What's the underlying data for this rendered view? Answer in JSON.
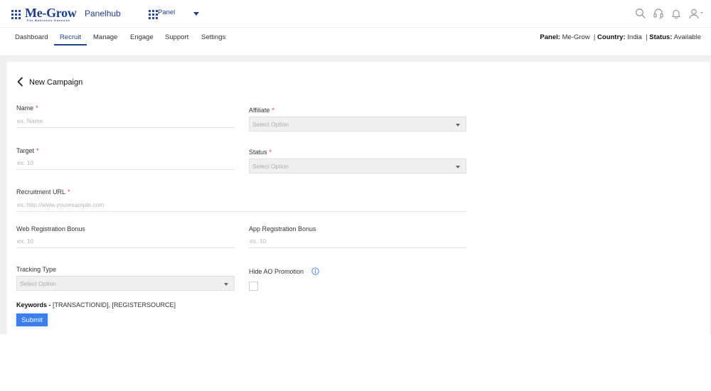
{
  "header": {
    "logo_text": "Me-Grow",
    "logo_subtext": "For Business Success",
    "brand": "Panelhub",
    "panel_select": "Panel",
    "icons": [
      "apps-grid-icon",
      "panel-grid-icon",
      "search-icon",
      "headset-icon",
      "bell-icon",
      "user-icon"
    ]
  },
  "nav": {
    "items": [
      "Dashboard",
      "Recruit",
      "Manage",
      "Engage",
      "Support",
      "Settings"
    ],
    "active": "Recruit"
  },
  "status": {
    "panel_label": "Panel",
    "panel_value": "Me-Grow",
    "country_label": "Country",
    "country_value": "India",
    "status_label": "Status",
    "status_value": "Available"
  },
  "page": {
    "title": "New Campaign"
  },
  "form": {
    "name": {
      "label": "Name",
      "placeholder": "ex. Name"
    },
    "affiliate": {
      "label": "Affiliate",
      "value": "Select Option"
    },
    "target": {
      "label": "Target",
      "placeholder": "ex. 10"
    },
    "status": {
      "label": "Status",
      "value": "Select Option"
    },
    "recruitment_url": {
      "label": "Recruitment URL",
      "placeholder": "ex. http://www.yourexample.com"
    },
    "web_bonus": {
      "label": "Web Registration Bonus",
      "placeholder": "ex. 10"
    },
    "app_bonus": {
      "label": "App Registration Bonus",
      "placeholder": "ex. 10"
    },
    "tracking_type": {
      "label": "Tracking Type",
      "value": "Select Option"
    },
    "hide_ao": {
      "label": "Hide AO Promotion",
      "checked": false
    },
    "required_mark": "*",
    "keywords_label": "Keywords -",
    "keywords_value": "[TRANSACTIONID], [REGISTERSOURCE]",
    "submit_label": "Submit"
  },
  "colors": {
    "brand_blue": "#1f3f8f",
    "primary_button": "#3b7ef0",
    "required": "#e0344b",
    "page_background": "#f0f0f0"
  }
}
